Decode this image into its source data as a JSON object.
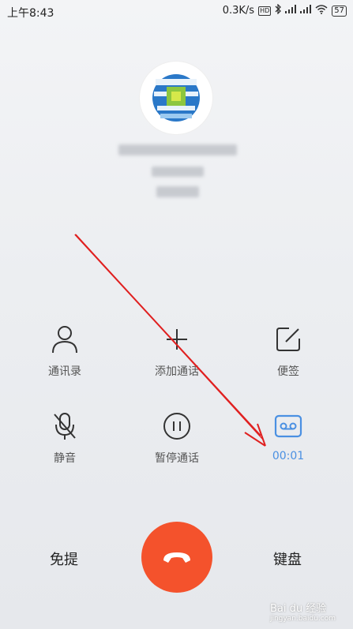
{
  "status_bar": {
    "time": "上午8:43",
    "network_speed": "0.3K/s",
    "hd_label": "HD",
    "battery": "57"
  },
  "actions": [
    {
      "label": "通讯录",
      "icon": "person-icon"
    },
    {
      "label": "添加通话",
      "icon": "plus-icon"
    },
    {
      "label": "便签",
      "icon": "note-icon"
    },
    {
      "label": "静音",
      "icon": "mute-mic-icon"
    },
    {
      "label": "暂停通话",
      "icon": "pause-icon"
    },
    {
      "label": "00:01",
      "icon": "record-icon"
    }
  ],
  "bottom": {
    "speaker_label": "免提",
    "keypad_label": "键盘"
  },
  "colors": {
    "end_call": "#f4522c",
    "record_active": "#4a90e2",
    "annotation_arrow": "#e02020"
  },
  "watermark": {
    "brand": "Bai du 经验",
    "url": "jingyan.baidu.com"
  }
}
